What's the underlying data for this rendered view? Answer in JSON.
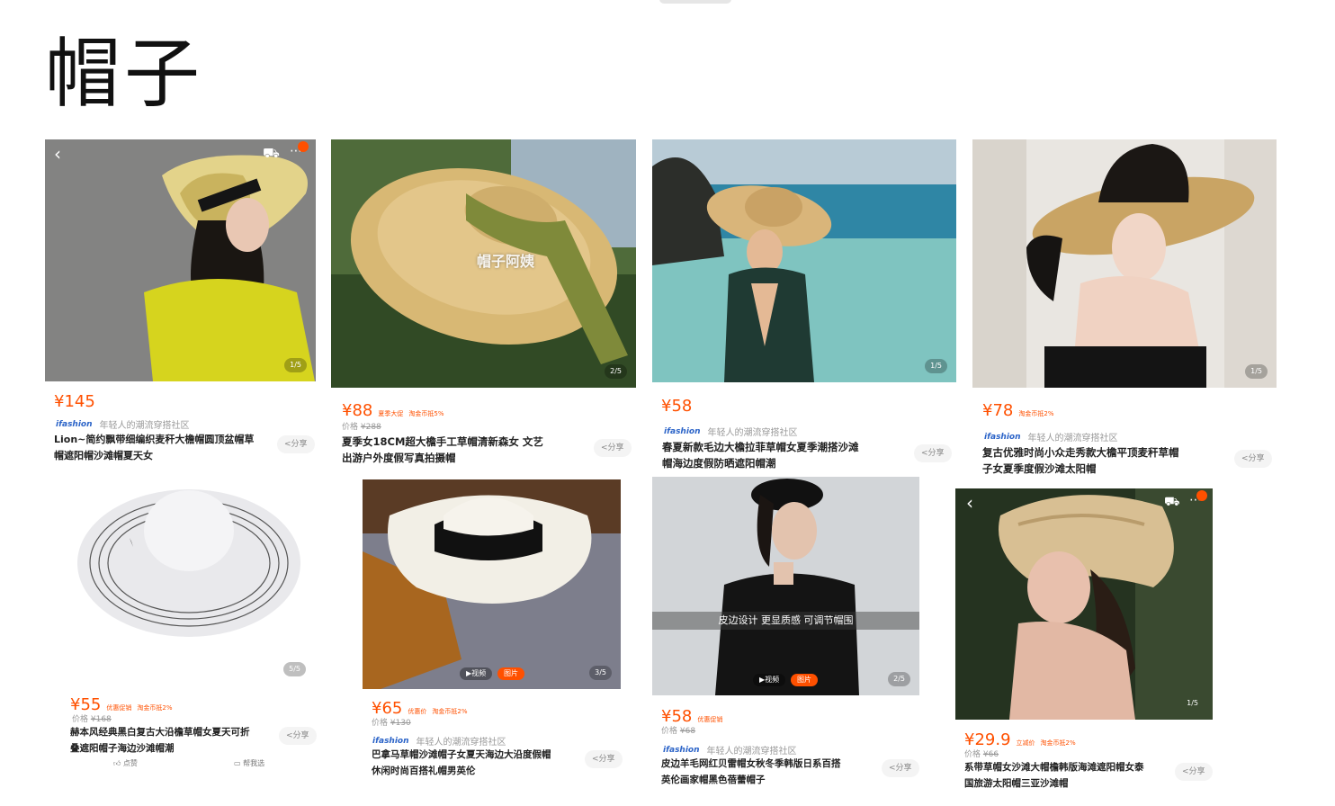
{
  "page": {
    "title": "帽子"
  },
  "products": [
    {
      "price": "¥145",
      "tags": [],
      "original_price": "",
      "shop_logo": "ifashion",
      "shop_name": "年轻人的潮流穿搭社区",
      "title_line1": "Lion~简约飘带细编织麦秆大檐帽圆顶盆帽草",
      "title_line2": "帽遮阳帽沙滩帽夏天女",
      "share_label": "<分享",
      "image_counter": "1/5",
      "image_desc": "woman-yellow-top-straw-hat"
    },
    {
      "price": "¥88",
      "tags": [
        "夏季大促",
        "淘金币抵5%"
      ],
      "original_price": "¥288",
      "shop_logo": "",
      "shop_name": "",
      "title_line1": "夏季女18CM超大檐手工草帽清新森女 文艺",
      "title_line2": "出游户外度假写真拍摄帽",
      "share_label": "<分享",
      "image_counter": "2/5",
      "watermark": "帽子阿姨",
      "image_desc": "wide-straw-hat-green-ribbon"
    },
    {
      "price": "¥58",
      "tags": [],
      "original_price": "",
      "shop_logo": "ifashion",
      "shop_name": "年轻人的潮流穿搭社区",
      "title_line1": "春夏新款毛边大檐拉菲草帽女夏季潮搭沙滩",
      "title_line2": "帽海边度假防晒遮阳帽潮",
      "share_label": "<分享",
      "image_counter": "1/5",
      "image_desc": "woman-beach-raffia-hat"
    },
    {
      "price": "¥78",
      "tags": [
        "淘金币抵2%"
      ],
      "original_price": "",
      "shop_logo": "ifashion",
      "shop_name": "年轻人的潮流穿搭社区",
      "title_line1": "复古优雅时尚小众走秀款大檐平顶麦秆草帽",
      "title_line2": "子女夏季度假沙滩太阳帽",
      "share_label": "<分享",
      "image_counter": "1/5",
      "image_desc": "woman-black-dress-flat-top-hat"
    },
    {
      "price": "¥55",
      "tags": [
        "优惠促销",
        "淘金币抵2%"
      ],
      "original_price": "¥168",
      "shop_logo": "",
      "shop_name": "",
      "title_line1": "赫本风经典黑白复古大沿檐草帽女夏天可折",
      "title_line2": "叠遮阳帽子海边沙滩帽潮",
      "share_label": "<分享",
      "image_counter": "5/5",
      "like_label": "点赞",
      "shortlist_label": "帮我选",
      "image_desc": "white-hat-black-stripes"
    },
    {
      "price": "¥65",
      "tags": [
        "优惠价",
        "淘金币抵2%"
      ],
      "original_price": "¥130",
      "shop_logo": "ifashion",
      "shop_name": "年轻人的潮流穿搭社区",
      "title_line1": "巴拿马草帽沙滩帽子女夏天海边大沿度假帽",
      "title_line2": "休闲时尚百搭礼帽男英伦",
      "share_label": "<分享",
      "image_counter": "3/5",
      "pill_video": "▶视频",
      "pill_image": "图片",
      "image_desc": "panama-hat-on-stool"
    },
    {
      "price": "¥58",
      "tags": [
        "优惠促销"
      ],
      "original_price": "¥68",
      "shop_logo": "ifashion",
      "shop_name": "年轻人的潮流穿搭社区",
      "title_line1": "皮边羊毛网红贝雷帽女秋冬季韩版日系百搭",
      "title_line2": "英伦画家帽黑色蓓蕾帽子",
      "share_label": "<分享",
      "image_counter": "2/5",
      "strip_text": "皮边设计   更显质感   可调节帽围",
      "pill_video": "▶视频",
      "pill_image": "图片",
      "image_desc": "woman-black-beret"
    },
    {
      "price": "¥29.9",
      "tags": [
        "立减价",
        "淘金币抵2%"
      ],
      "original_price": "¥66",
      "shop_logo": "",
      "shop_name": "",
      "title_line1": "系带草帽女沙滩大帽檐韩版海滩遮阳帽女泰",
      "title_line2": "国旅游太阳帽三亚沙滩帽",
      "share_label": "<分享",
      "image_counter": "1/5",
      "image_desc": "woman-crochet-hat"
    }
  ],
  "colors": {
    "accent": "#ff5000",
    "shop_blue": "#2c64c8"
  },
  "icons": [
    "back-arrow-icon",
    "cart-icon",
    "more-icon",
    "thumbs-up-icon",
    "share-icon"
  ]
}
